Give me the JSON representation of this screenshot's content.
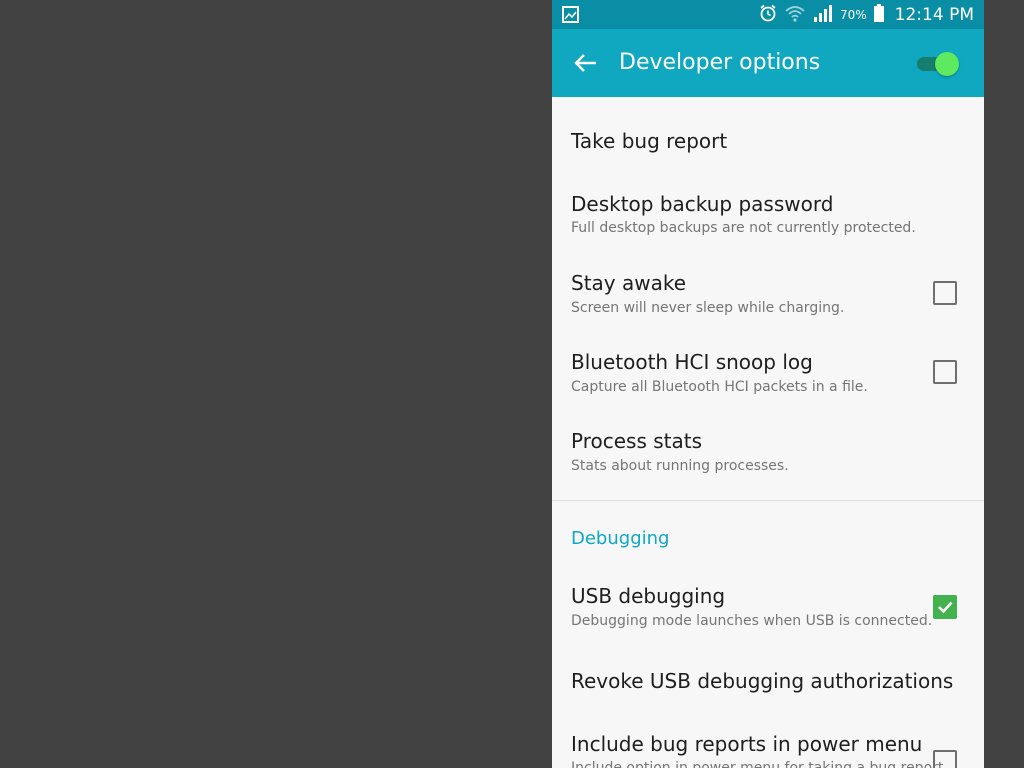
{
  "status_bar": {
    "battery_percent": "70%",
    "time": "12:14 PM",
    "icons": [
      "image-icon",
      "alarm-icon",
      "wifi-icon",
      "signal-icon",
      "battery-icon"
    ]
  },
  "app_bar": {
    "title": "Developer options",
    "master_toggle_on": true
  },
  "items": [
    {
      "title": "Take bug report"
    },
    {
      "title": "Desktop backup password",
      "subtitle": "Full desktop backups are not currently protected."
    },
    {
      "title": "Stay awake",
      "subtitle": "Screen will never sleep while charging.",
      "checked": false
    },
    {
      "title": "Bluetooth HCI snoop log",
      "subtitle": "Capture all Bluetooth HCI packets in a file.",
      "checked": false
    },
    {
      "title": "Process stats",
      "subtitle": "Stats about running processes."
    }
  ],
  "debugging": {
    "header": "Debugging",
    "items": [
      {
        "title": "USB debugging",
        "subtitle": "Debugging mode launches when USB is connected.",
        "checked": true
      },
      {
        "title": "Revoke USB debugging authorizations"
      },
      {
        "title": "Include bug reports in power menu",
        "subtitle": "Include option in power menu for taking a bug report.",
        "checked": false
      }
    ]
  },
  "colors": {
    "status_bar": "#0a8ea6",
    "app_bar": "#10a7c1",
    "accent": "#10a7c1",
    "checkbox_checked": "#43b14e",
    "toggle_thumb": "#5eea5e",
    "background_outside": "#424242"
  }
}
